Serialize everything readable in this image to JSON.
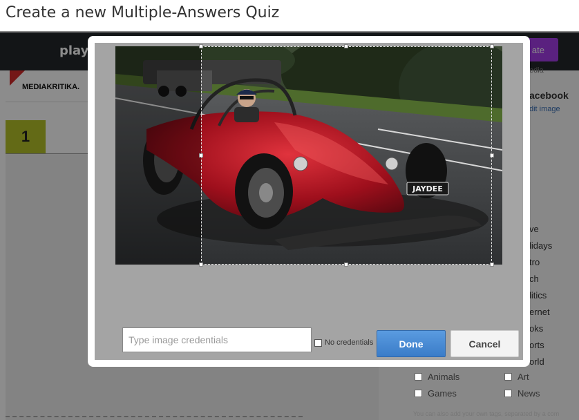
{
  "page": {
    "title": "Create a new Multiple-Answers Quiz"
  },
  "topbar": {
    "brand": "play",
    "create_label": "ate"
  },
  "left": {
    "logo_text": "MEDIAKRITIKA.",
    "question_number": "1"
  },
  "right_fragments": {
    "media": "edia",
    "facebook": "acebook",
    "edit_image": "dit image",
    "tags_partial": [
      "ve",
      "lidays",
      "tro",
      "ch",
      "litics",
      "ernet",
      "oks",
      "orts",
      "orld"
    ],
    "tags_full": [
      {
        "label": "Animals"
      },
      {
        "label": "Art"
      },
      {
        "label": "Games"
      },
      {
        "label": "News"
      }
    ],
    "hint": "You can also add your own tags, separated by a com"
  },
  "modal": {
    "photo": {
      "plate": "JAYDEE"
    },
    "credits_placeholder": "Type image credentials",
    "no_credentials_label": "No credentials",
    "done_label": "Done",
    "cancel_label": "Cancel"
  },
  "colors": {
    "topbar": "#23272b",
    "create_accent": "#a43de8",
    "question_badge": "#b4c229",
    "done": "#3a7cc8"
  }
}
